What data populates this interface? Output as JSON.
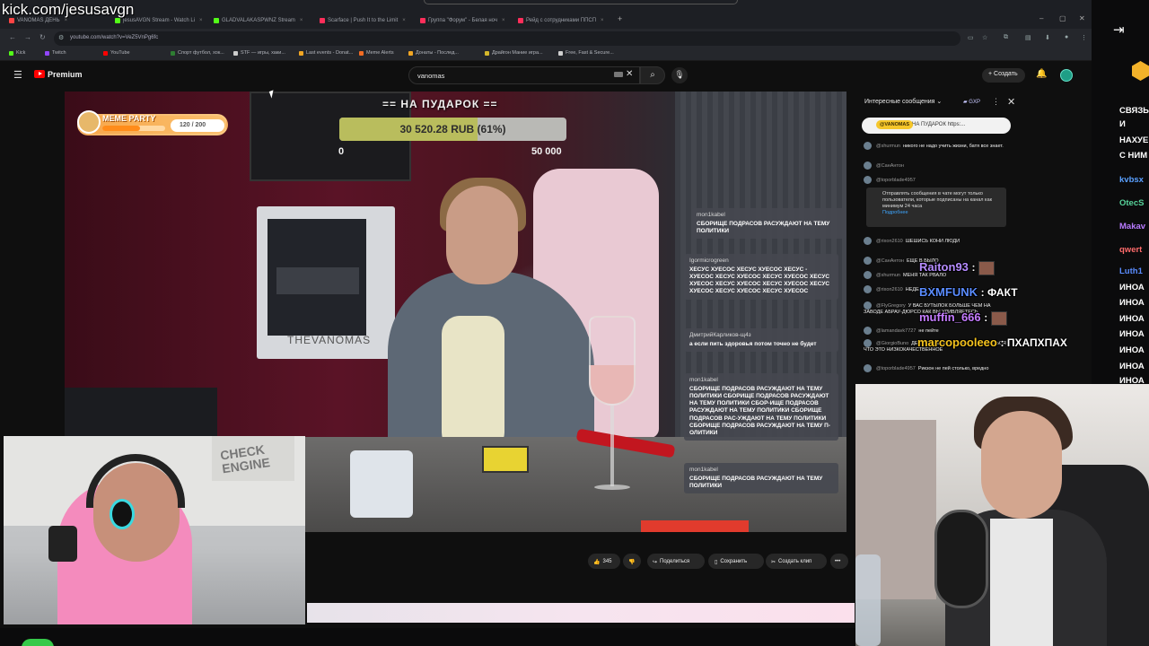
{
  "stream_overlay": {
    "url_text": "kick.com/jesusavgn"
  },
  "browser": {
    "tabs": [
      {
        "label": "VANOMAS ДЕНЬ",
        "color": "#ff4444"
      },
      {
        "label": "jesusAVGN Stream - Watch Li",
        "color": "#53fc18"
      },
      {
        "label": "GLADVALAKASPWNZ Stream",
        "color": "#53fc18"
      },
      {
        "label": "Scarface | Push It to the Limit",
        "color": "#ff2e5a"
      },
      {
        "label": "Группа \"Форум\" - Белая ноч",
        "color": "#ff2e5a"
      },
      {
        "label": "Рейд с сотрудниками ППСП",
        "color": "#ff2e5a"
      }
    ],
    "new_tab": "+",
    "window_controls": {
      "minimize": "–",
      "maximize": "▢",
      "close": "✕"
    },
    "url": "youtube.com/watch?v=VeZ5VnPg6fc",
    "bookmarks": [
      {
        "label": "Kick",
        "color": "#53fc18"
      },
      {
        "label": "Twitch",
        "color": "#9146ff"
      },
      {
        "label": "YouTube",
        "color": "#ff0000"
      },
      {
        "label": "Спорт футбол, хок...",
        "color": "#2e7d32"
      },
      {
        "label": "STF — игры, хаки...",
        "color": "#cccccc"
      },
      {
        "label": "Last events - Donat...",
        "color": "#f2a623"
      },
      {
        "label": "Meme Alerts",
        "color": "#f26c23"
      },
      {
        "label": "Донаты - Послед...",
        "color": "#f2a623"
      },
      {
        "label": "Драйгон Мание игра...",
        "color": "#d4b72b"
      },
      {
        "label": "Free, Fast & Secure...",
        "color": "#d0d0d0"
      }
    ]
  },
  "youtube": {
    "logo_text": "Premium",
    "search_value": "vanomas",
    "create_label": "Создать"
  },
  "video": {
    "donation": {
      "label": "== НА ПУДАРОК ==",
      "amount_text": "30 520.28 RUB (61%)",
      "progress": 0.61,
      "min": "0",
      "max": "50 000"
    },
    "meme_party": {
      "title": "MEME PARTY",
      "count": "120 / 200",
      "progress": 0.6
    },
    "pc_label": "THEVANOMAS",
    "chat_overlay": [
      {
        "user": "mon1kabel",
        "text": "СБОРИЩЕ ПОДРАСОВ РАСУЖДАЮТ НА ТЕМУ ПОЛИТИКИ"
      },
      {
        "user": "Igormicrogreen",
        "text": "ХЕСУС ХУЕСОС ХЕСУС ХУЕСОС ХЕСУС - ХУЕСОС ХЕСУС ХУЕСОС ХЕСУС ХУЕСОС ХЕСУС ХУЕСОС ХЕСУС ХУЕСОС ХЕСУС ХУЕСОС ХЕСУС ХУЕСОС ХЕСУС ХУЕСОС ХЕСУС ХУЕСОС"
      },
      {
        "user": "ДмитрийКарликов-щ4з",
        "text": "а если пить здоровья потом точно не будет"
      },
      {
        "user": "mon1kabel",
        "text": "СБОРИЩЕ ПОДРАСОВ РАСУЖДАЮТ НА ТЕМУ ПОЛИТИКИ СБОРИЩЕ ПОДРАСОВ РАСУЖДАЮТ НА ТЕМУ ПОЛИТИКИ СБОР-ИЩЕ ПОДРАСОВ РАСУЖДАЮТ НА ТЕМУ ПОЛИТИКИ СБОРИЩЕ ПОДРАСОВ РАС-УЖДАЮТ НА ТЕМУ ПОЛИТИКИ СБОРИЩЕ ПОДРАСОВ РАСУЖДАЮТ НА ТЕМУ П-ОЛИТИКИ"
      },
      {
        "user": "mon1kabel",
        "text": "СБОРИЩЕ ПОДРАСОВ РАСУЖДАЮТ НА ТЕМУ ПОЛИТИКИ"
      }
    ]
  },
  "video_actions": {
    "likes": "345",
    "share": "Поделиться",
    "save": "Сохранить",
    "clip": "Создать клип",
    "more": "•••"
  },
  "live_chat": {
    "header": "Интересные сообщения",
    "gxp": "GXP",
    "pinned_user": "@VANOMAS",
    "pinned_text": "НА ПУДАРОК https:...",
    "rows": [
      {
        "name": "@shurmun",
        "text": "никого не надо учить жизни, батя все знает."
      },
      {
        "name": "@СанАнтон",
        "text": ""
      },
      {
        "name": "@toporblade4957",
        "text": ""
      }
    ],
    "notice_text": "Отправлять сообщения в чате могут только пользователи, которые подписаны на канал как минимум 24 часа",
    "notice_link": "Подробнее",
    "rows2": [
      {
        "name": "@rixon2610",
        "text": "ШЕШИСЬ КОНИ ЛЮДИ"
      },
      {
        "name": "@СанАнтон",
        "text": "ЕЩЕ В БЫЛО"
      },
      {
        "name": "@shurmun",
        "text": "МЕНЯ ТАК РВАЛО"
      },
      {
        "name": "@rixon2610",
        "text": "НЕДЕЛЮ ТАК"
      },
      {
        "name": "@FlyGregory",
        "text": "У ВАС БУТЫЛОК БОЛЬШЕ ЧЕМ НА ЗАВОДЕ АБРАУ-ДЮРСО КАК ВЫ УДИВЛЯЕТЕСЬ"
      },
      {
        "name": "@lamandavk7727",
        "text": "не пейте"
      },
      {
        "name": "@GiorgioBuno",
        "text": "ДЕШЕВОЕ И НЕ ПОНЯЛ УДИВЛЯЕТЬСЯ ЧТО ЭТО НИЗКОКАЧЕСТВЕННОЕ"
      },
      {
        "name": "@toporblade4957",
        "text": "Рикзон не пей столько, вредно"
      }
    ]
  },
  "streamer_chat": [
    {
      "user": "Raiton93",
      "msg": ":",
      "color": "#b68cff",
      "emote": true
    },
    {
      "user": "BXMFUNK",
      "msg": ": ФАКТ",
      "color": "#5a8cff",
      "emote": false
    },
    {
      "user": "muffin_666",
      "msg": ":",
      "color": "#c47cff",
      "emote": true
    },
    {
      "user": "marcopooleeo",
      "msg": ": ПХАПХПАХ",
      "color": "#f3c21e",
      "emote": false
    }
  ],
  "kick_chat": [
    {
      "text": "СВЯЗЫ",
      "color": "#ffffff"
    },
    {
      "text": "И",
      "color": "#ffffff"
    },
    {
      "text": "НАХУЕ",
      "color": "#ffffff"
    },
    {
      "text": "С НИМ",
      "color": "#ffffff"
    },
    {
      "text": "kvbsx",
      "color": "#5aa0ff"
    },
    {
      "text": "OtecS",
      "color": "#57d39a"
    },
    {
      "text": "Makav",
      "color": "#b87bff"
    },
    {
      "text": "qwert",
      "color": "#ff6b6b"
    },
    {
      "text": "Luth1",
      "color": "#5a8cff"
    },
    {
      "text": "ИНОА",
      "color": "#ffffff"
    },
    {
      "text": "ИНОА",
      "color": "#ffffff"
    },
    {
      "text": "ИНОА",
      "color": "#ffffff"
    },
    {
      "text": "ИНОА",
      "color": "#ffffff"
    },
    {
      "text": "ИНОА",
      "color": "#ffffff"
    },
    {
      "text": "ИНОА",
      "color": "#ffffff"
    },
    {
      "text": "ИНОА",
      "color": "#ffffff"
    }
  ],
  "left_cam": {
    "poster_text": "CHECK ENGINE"
  }
}
